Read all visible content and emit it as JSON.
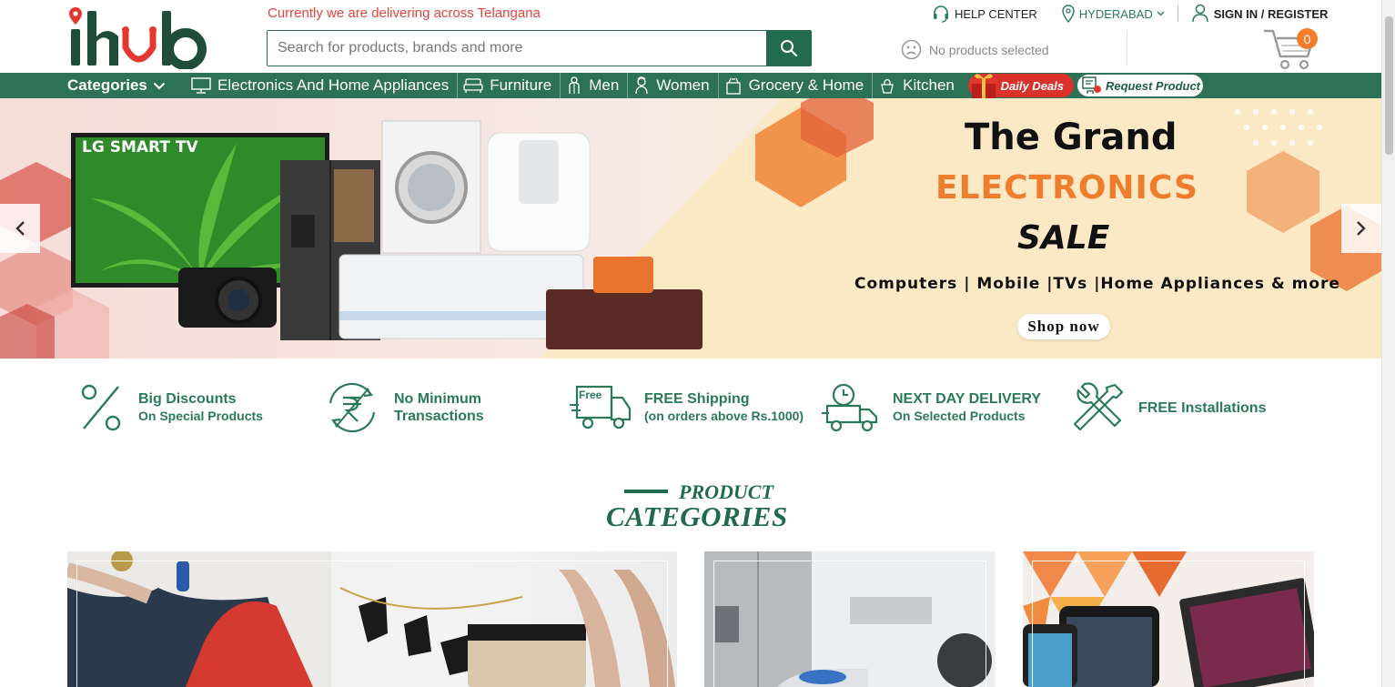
{
  "header": {
    "logo_text": "ihub",
    "delivery_note": "Currently we are delivering across Telangana",
    "search_placeholder": "Search for products, brands and more",
    "help_center": "HELP CENTER",
    "city": "HYDERABAD",
    "signin": "SIGN IN / REGISTER",
    "no_products": "No products selected",
    "cart_count": "0"
  },
  "nav": {
    "categories_label": "Categories",
    "items": [
      {
        "label": "Electronics And Home Appliances",
        "icon": "monitor-icon"
      },
      {
        "label": "Furniture",
        "icon": "sofa-icon"
      },
      {
        "label": "Men",
        "icon": "man-icon"
      },
      {
        "label": "Women",
        "icon": "woman-icon"
      },
      {
        "label": "Grocery & Home",
        "icon": "grocery-bag-icon"
      },
      {
        "label": "Kitchen",
        "icon": "kitchen-icon"
      }
    ],
    "daily_deals": "Daily Deals",
    "request_product": "Request Product"
  },
  "banner": {
    "product_label": "LG SMART TV",
    "title": "The Grand",
    "subtitle": "ELECTRONICS",
    "sale": "SALE",
    "tagline": "Computers | Mobile |TVs |Home Appliances & more",
    "cta": "Shop now"
  },
  "features": [
    {
      "title": "Big Discounts",
      "sub": "On Special Products",
      "icon": "percent-icon"
    },
    {
      "title": "No Minimum",
      "sub": "Transactions",
      "icon": "rupee-cycle-icon"
    },
    {
      "title": "FREE Shipping",
      "sub": "(on orders above Rs.1000)",
      "icon": "free-truck-icon"
    },
    {
      "title": "NEXT DAY DELIVERY",
      "sub": "On Selected Products",
      "icon": "delivery-truck-icon"
    },
    {
      "title": "FREE Installations",
      "sub": "",
      "icon": "tools-icon"
    }
  ],
  "product_categories": {
    "heading_top": "PRODUCT",
    "heading_bottom": "CATEGORIES"
  },
  "colors": {
    "brand_green": "#2d7157",
    "accent_orange": "#ef7e2c",
    "alert_red": "#e0443c"
  }
}
